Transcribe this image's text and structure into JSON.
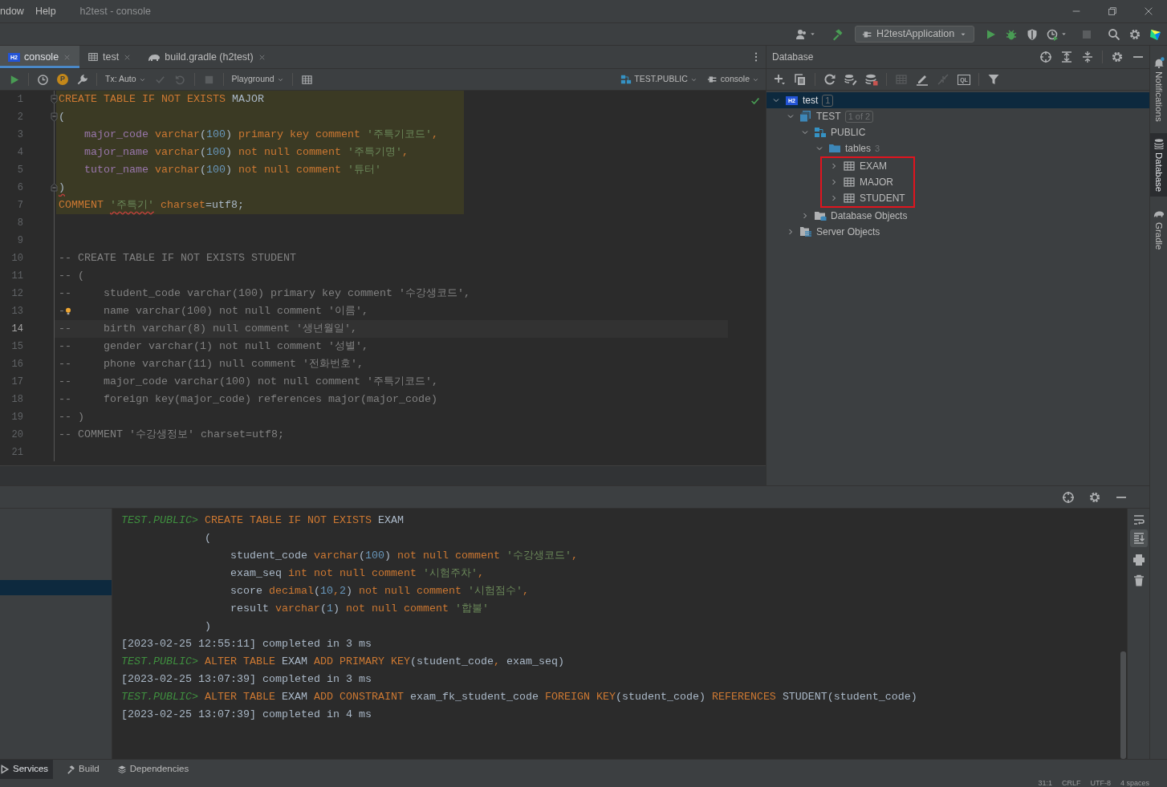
{
  "menu": [
    "ndow",
    "Help"
  ],
  "window": {
    "title": "h2test - console"
  },
  "run_config": {
    "label": "H2testApplication"
  },
  "editor_tabs": [
    {
      "label": "console",
      "kind": "h2",
      "icon_text": "H2",
      "selected": true
    },
    {
      "label": "test",
      "kind": "table",
      "selected": false
    },
    {
      "label": "build.gradle (h2test)",
      "kind": "gradle",
      "selected": false
    }
  ],
  "editor_toolbar": {
    "p_icon": "P",
    "tx": "Tx: Auto",
    "playground": "Playground",
    "schema": "TEST.PUBLIC",
    "session": "console"
  },
  "editor": {
    "lines": [
      {
        "number": "1",
        "fold_start": true,
        "highlighted": true,
        "current": false,
        "tokens": [
          {
            "kind": "kw",
            "text": "CREATE TABLE IF NOT EXISTS "
          },
          {
            "kind": "plain",
            "text": "MAJOR"
          }
        ]
      },
      {
        "number": "2",
        "fold_start": true,
        "highlighted": true,
        "current": false,
        "tokens": [
          {
            "kind": "plain",
            "text": "("
          }
        ]
      },
      {
        "number": "3",
        "highlighted": true,
        "current": false,
        "tokens": [
          {
            "kind": "col",
            "text": "    major_code"
          },
          {
            "kind": "kw",
            "text": " varchar"
          },
          {
            "kind": "plain",
            "text": "("
          },
          {
            "kind": "num",
            "text": "100"
          },
          {
            "kind": "plain",
            "text": ")"
          },
          {
            "kind": "kw",
            "text": " primary key comment "
          },
          {
            "kind": "str",
            "text": "'주특기코드'"
          },
          {
            "kind": "kw",
            "text": ","
          }
        ]
      },
      {
        "number": "4",
        "highlighted": true,
        "current": false,
        "tokens": [
          {
            "kind": "col",
            "text": "    major_name"
          },
          {
            "kind": "kw",
            "text": " varchar"
          },
          {
            "kind": "plain",
            "text": "("
          },
          {
            "kind": "num",
            "text": "100"
          },
          {
            "kind": "plain",
            "text": ")"
          },
          {
            "kind": "kw",
            "text": " not null comment "
          },
          {
            "kind": "str",
            "text": "'주특기명'"
          },
          {
            "kind": "kw",
            "text": ","
          }
        ]
      },
      {
        "number": "5",
        "highlighted": true,
        "current": false,
        "tokens": [
          {
            "kind": "col",
            "text": "    tutor_name"
          },
          {
            "kind": "kw",
            "text": " varchar"
          },
          {
            "kind": "plain",
            "text": "("
          },
          {
            "kind": "num",
            "text": "100"
          },
          {
            "kind": "plain",
            "text": ")"
          },
          {
            "kind": "kw",
            "text": " not null comment "
          },
          {
            "kind": "str",
            "text": "'튜터'"
          }
        ]
      },
      {
        "number": "6",
        "fold_end": true,
        "highlighted": true,
        "current": false,
        "tokens": [
          {
            "kind": "plain",
            "text": ")",
            "error": true
          }
        ]
      },
      {
        "number": "7",
        "highlighted": true,
        "current": false,
        "tokens": [
          {
            "kind": "kw",
            "text": "COMMENT "
          },
          {
            "kind": "str",
            "text": "'주특기'",
            "error": true
          },
          {
            "kind": "kw",
            "text": " charset"
          },
          {
            "kind": "plain",
            "text": "=utf8;"
          }
        ]
      },
      {
        "number": "8",
        "highlighted": false,
        "current": false
      },
      {
        "number": "9",
        "highlighted": false,
        "current": false
      },
      {
        "number": "10",
        "highlighted": false,
        "current": false,
        "tokens": [
          {
            "kind": "com",
            "text": "-- CREATE TABLE IF NOT EXISTS STUDENT"
          }
        ]
      },
      {
        "number": "11",
        "highlighted": false,
        "current": false,
        "tokens": [
          {
            "kind": "com",
            "text": "-- ("
          }
        ]
      },
      {
        "number": "12",
        "highlighted": false,
        "current": false,
        "tokens": [
          {
            "kind": "com",
            "text": "--     student_code varchar(100) primary key comment '수강생코드',"
          }
        ]
      },
      {
        "number": "13",
        "highlighted": false,
        "current": false,
        "tokens": [
          {
            "kind": "com",
            "text": "-"
          },
          {
            "kind": "bulb"
          },
          {
            "kind": "com",
            "text": "     name varchar(100) not null comment '이름',"
          }
        ]
      },
      {
        "number": "14",
        "highlighted": false,
        "current": true,
        "tokens": [
          {
            "kind": "com",
            "text": "--     birth varchar(8) null comment '생년월일',"
          }
        ]
      },
      {
        "number": "15",
        "highlighted": false,
        "current": false,
        "tokens": [
          {
            "kind": "com",
            "text": "--     gender varchar(1) not null comment '성별',"
          }
        ]
      },
      {
        "number": "16",
        "highlighted": false,
        "current": false,
        "tokens": [
          {
            "kind": "com",
            "text": "--     phone varchar(11) null comment '전화번호',"
          }
        ]
      },
      {
        "number": "17",
        "highlighted": false,
        "current": false,
        "tokens": [
          {
            "kind": "com",
            "text": "--     major_code varchar(100) not null comment '주특기코드',"
          }
        ]
      },
      {
        "number": "18",
        "highlighted": false,
        "current": false,
        "tokens": [
          {
            "kind": "com",
            "text": "--     foreign key(major_code) references major(major_code)"
          }
        ]
      },
      {
        "number": "19",
        "highlighted": false,
        "current": false,
        "tokens": [
          {
            "kind": "com",
            "text": "-- )"
          }
        ]
      },
      {
        "number": "20",
        "highlighted": false,
        "current": false,
        "tokens": [
          {
            "kind": "com",
            "text": "-- COMMENT '수강생정보' charset=utf8;"
          }
        ]
      },
      {
        "number": "21",
        "highlighted": false,
        "current": false
      }
    ]
  },
  "database_panel": {
    "title": "Database",
    "ql_icon": "QL",
    "tree": [
      {
        "label": "test",
        "kind": "h2",
        "icon_text": "H2",
        "badge": "1",
        "expanded": true,
        "selected": true,
        "children": [
          {
            "label": "TEST",
            "kind": "database",
            "badge": "1 of 2",
            "expanded": true,
            "selected": false,
            "children": [
              {
                "label": "PUBLIC",
                "kind": "schema",
                "expanded": true,
                "selected": false,
                "children": [
                  {
                    "label": "tables",
                    "kind": "folder",
                    "count": "3",
                    "expanded": true,
                    "selected": false,
                    "outlined": true,
                    "children": [
                      {
                        "label": "EXAM",
                        "kind": "table",
                        "expanded": false,
                        "selected": false
                      },
                      {
                        "label": "MAJOR",
                        "kind": "table",
                        "expanded": false,
                        "selected": false
                      },
                      {
                        "label": "STUDENT",
                        "kind": "table",
                        "expanded": false,
                        "selected": false
                      }
                    ]
                  }
                ]
              },
              {
                "label": "Database Objects",
                "kind": "objects",
                "expanded": false,
                "selected": false
              }
            ]
          },
          {
            "label": "Server Objects",
            "kind": "server",
            "expanded": false,
            "selected": false
          }
        ]
      }
    ]
  },
  "side_tabs": [
    {
      "label": "Notifications",
      "kind": "bell",
      "selected": false
    },
    {
      "label": "Database",
      "kind": "database",
      "selected": true
    },
    {
      "label": "Gradle",
      "kind": "gradle",
      "selected": false
    }
  ],
  "services": {
    "output": [
      {
        "tokens": [
          {
            "kind": "prompt",
            "text": "TEST.PUBLIC> "
          },
          {
            "kind": "kw",
            "text": "CREATE TABLE IF NOT EXISTS "
          },
          {
            "kind": "plain",
            "text": "EXAM"
          }
        ]
      },
      {
        "tokens": [
          {
            "kind": "plain",
            "text": "             ("
          }
        ]
      },
      {
        "tokens": [
          {
            "kind": "plain",
            "text": "                 student_code "
          },
          {
            "kind": "kw",
            "text": "varchar"
          },
          {
            "kind": "plain",
            "text": "("
          },
          {
            "kind": "num",
            "text": "100"
          },
          {
            "kind": "plain",
            "text": ")"
          },
          {
            "kind": "kw",
            "text": " not null comment "
          },
          {
            "kind": "str",
            "text": "'수강생코드'"
          },
          {
            "kind": "kw",
            "text": ","
          }
        ]
      },
      {
        "tokens": [
          {
            "kind": "plain",
            "text": "                 exam_seq "
          },
          {
            "kind": "kw",
            "text": "int not null comment "
          },
          {
            "kind": "str",
            "text": "'시험주차'"
          },
          {
            "kind": "kw",
            "text": ","
          }
        ]
      },
      {
        "tokens": [
          {
            "kind": "plain",
            "text": "                 score "
          },
          {
            "kind": "kw",
            "text": "decimal"
          },
          {
            "kind": "plain",
            "text": "("
          },
          {
            "kind": "num",
            "text": "10"
          },
          {
            "kind": "kw",
            "text": ","
          },
          {
            "kind": "num",
            "text": "2"
          },
          {
            "kind": "plain",
            "text": ")"
          },
          {
            "kind": "kw",
            "text": " not null comment "
          },
          {
            "kind": "str",
            "text": "'시험점수'"
          },
          {
            "kind": "kw",
            "text": ","
          }
        ]
      },
      {
        "tokens": [
          {
            "kind": "plain",
            "text": "                 result "
          },
          {
            "kind": "kw",
            "text": "varchar"
          },
          {
            "kind": "plain",
            "text": "("
          },
          {
            "kind": "num",
            "text": "1"
          },
          {
            "kind": "plain",
            "text": ")"
          },
          {
            "kind": "kw",
            "text": " not null comment "
          },
          {
            "kind": "str",
            "text": "'합불'"
          }
        ]
      },
      {
        "tokens": [
          {
            "kind": "plain",
            "text": "             )"
          }
        ]
      },
      {
        "tokens": [
          {
            "kind": "plain",
            "text": "[2023-02-25 12:55:11] completed in 3 ms"
          }
        ]
      },
      {
        "tokens": [
          {
            "kind": "prompt",
            "text": "TEST.PUBLIC> "
          },
          {
            "kind": "kw",
            "text": "ALTER TABLE "
          },
          {
            "kind": "plain",
            "text": "EXAM "
          },
          {
            "kind": "kw",
            "text": "ADD PRIMARY KEY"
          },
          {
            "kind": "plain",
            "text": "(student_code"
          },
          {
            "kind": "kw",
            "text": ","
          },
          {
            "kind": "plain",
            "text": " exam_seq)"
          }
        ]
      },
      {
        "tokens": [
          {
            "kind": "plain",
            "text": "[2023-02-25 13:07:39] completed in 3 ms"
          }
        ]
      },
      {
        "tokens": [
          {
            "kind": "prompt",
            "text": "TEST.PUBLIC> "
          },
          {
            "kind": "kw",
            "text": "ALTER TABLE "
          },
          {
            "kind": "plain",
            "text": "EXAM "
          },
          {
            "kind": "kw",
            "text": "ADD CONSTRAINT "
          },
          {
            "kind": "plain",
            "text": "exam_fk_student_code "
          },
          {
            "kind": "kw",
            "text": "FOREIGN KEY"
          },
          {
            "kind": "plain",
            "text": "(student_code) "
          },
          {
            "kind": "kw",
            "text": "REFERENCES "
          },
          {
            "kind": "plain",
            "text": "STUDENT(student_code)"
          }
        ]
      },
      {
        "tokens": [
          {
            "kind": "plain",
            "text": "[2023-02-25 13:07:39] completed in 4 ms"
          }
        ]
      }
    ]
  },
  "bottom_tabs": [
    {
      "label": "Services",
      "kind": "services",
      "selected": true
    },
    {
      "label": "Build",
      "kind": "build",
      "selected": false
    },
    {
      "label": "Dependencies",
      "kind": "dependencies",
      "selected": false
    }
  ],
  "status_bar": [
    "31:1",
    "CRLF",
    "UTF-8",
    "4 spaces"
  ]
}
